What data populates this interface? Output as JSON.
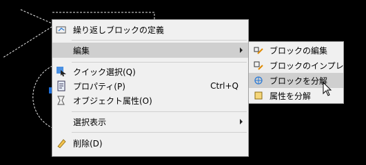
{
  "main_menu": {
    "items": [
      {
        "label": "繰り返しブロックの定義",
        "icon": "repeat-block-icon"
      },
      {
        "label": "編集",
        "icon": "",
        "has_submenu": true,
        "highlighted": true
      },
      {
        "label": "クイック選択(Q)",
        "icon": "quick-select-icon"
      },
      {
        "label": "プロパティ(P)",
        "icon": "properties-icon",
        "shortcut": "Ctrl+Q"
      },
      {
        "label": "オブジェクト属性(O)",
        "icon": "object-attributes-icon"
      },
      {
        "label": "選択表示",
        "icon": "",
        "has_submenu": true
      },
      {
        "label": "削除(D)",
        "icon": "eraser-icon"
      }
    ]
  },
  "sub_menu": {
    "items": [
      {
        "label": "ブロックの編集",
        "icon": "block-edit-icon"
      },
      {
        "label": "ブロックのインプレイス編集",
        "icon": "block-inplace-edit-icon"
      },
      {
        "label": "ブロックを分解",
        "icon": "explode-block-icon",
        "highlighted": true
      },
      {
        "label": "属性を分解",
        "icon": "explode-attributes-icon"
      }
    ]
  },
  "colors": {
    "background": "#000000",
    "menu_bg": "#f0f0f0",
    "highlight": "#cfcfcf",
    "selection_grip": "#1e6fd9"
  }
}
